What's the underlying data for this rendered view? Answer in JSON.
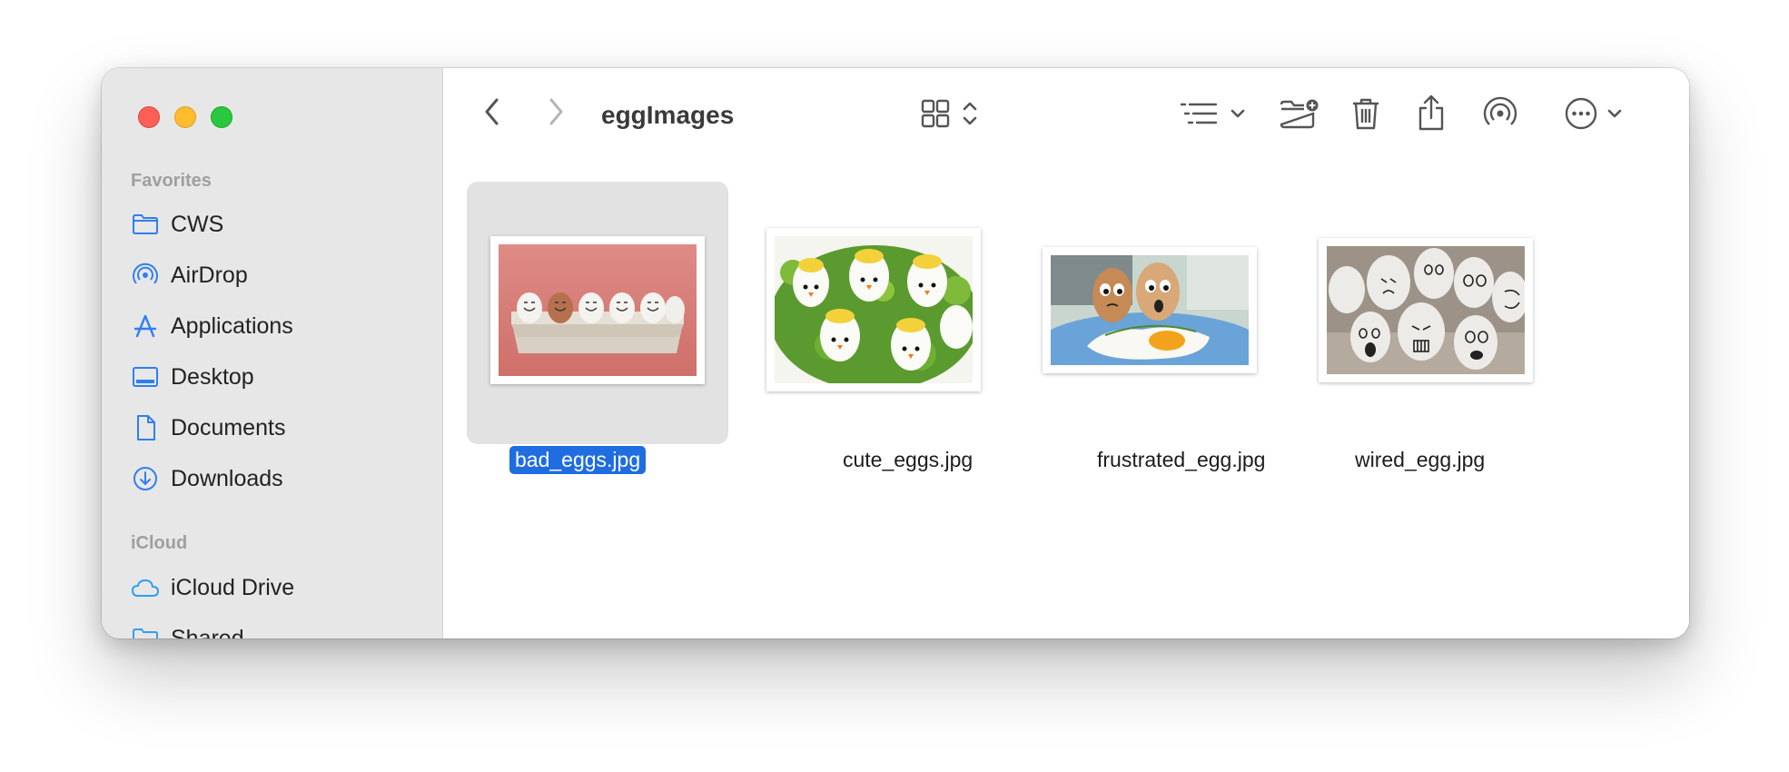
{
  "window": {
    "title": "eggImages"
  },
  "sidebar": {
    "favorites_title": "Favorites",
    "favorites": [
      {
        "label": "CWS",
        "icon": "folder-icon"
      },
      {
        "label": "AirDrop",
        "icon": "airdrop-icon"
      },
      {
        "label": "Applications",
        "icon": "applications-icon"
      },
      {
        "label": "Desktop",
        "icon": "desktop-icon"
      },
      {
        "label": "Documents",
        "icon": "document-icon"
      },
      {
        "label": "Downloads",
        "icon": "downloads-icon"
      }
    ],
    "icloud_title": "iCloud",
    "icloud": [
      {
        "label": "iCloud Drive",
        "icon": "icloud-icon"
      },
      {
        "label": "Shared",
        "icon": "shared-folder-icon"
      }
    ]
  },
  "files": [
    {
      "name": "bad_eggs.jpg",
      "selected": true
    },
    {
      "name": "cute_eggs.jpg",
      "selected": false
    },
    {
      "name": "frustrated_egg.jpg",
      "selected": false
    },
    {
      "name": "wired_egg.jpg",
      "selected": false
    }
  ],
  "colors": {
    "accent": "#1f6de0",
    "sidebar_icon": "#2f7ff0"
  }
}
